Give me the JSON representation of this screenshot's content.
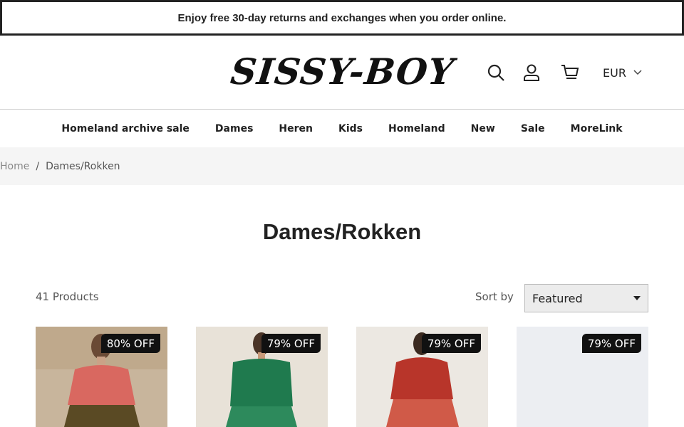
{
  "announcement": "Enjoy free 30-day returns and exchanges when you order online.",
  "logo_text": "SISSY-BOY",
  "header_icons": [
    "search-icon",
    "account-icon",
    "cart-icon"
  ],
  "currency": "EUR",
  "nav": [
    "Homeland archive sale",
    "Dames",
    "Heren",
    "Kids",
    "Homeland",
    "New",
    "Sale",
    "MoreLink"
  ],
  "breadcrumb": {
    "home": "Home",
    "separator": "/",
    "current": "Dames/Rokken"
  },
  "page_title": "Dames/Rokken",
  "product_count": "41 Products",
  "sort": {
    "label": "Sort by",
    "selected": "Featured"
  },
  "products": [
    {
      "badge": "80% OFF"
    },
    {
      "badge": "79% OFF"
    },
    {
      "badge": "79% OFF"
    },
    {
      "badge": "79% OFF"
    }
  ],
  "colors": {
    "badge_bg": "#111111",
    "breadcrumb_bg": "#f5f5f5",
    "select_bg": "#ececec"
  }
}
